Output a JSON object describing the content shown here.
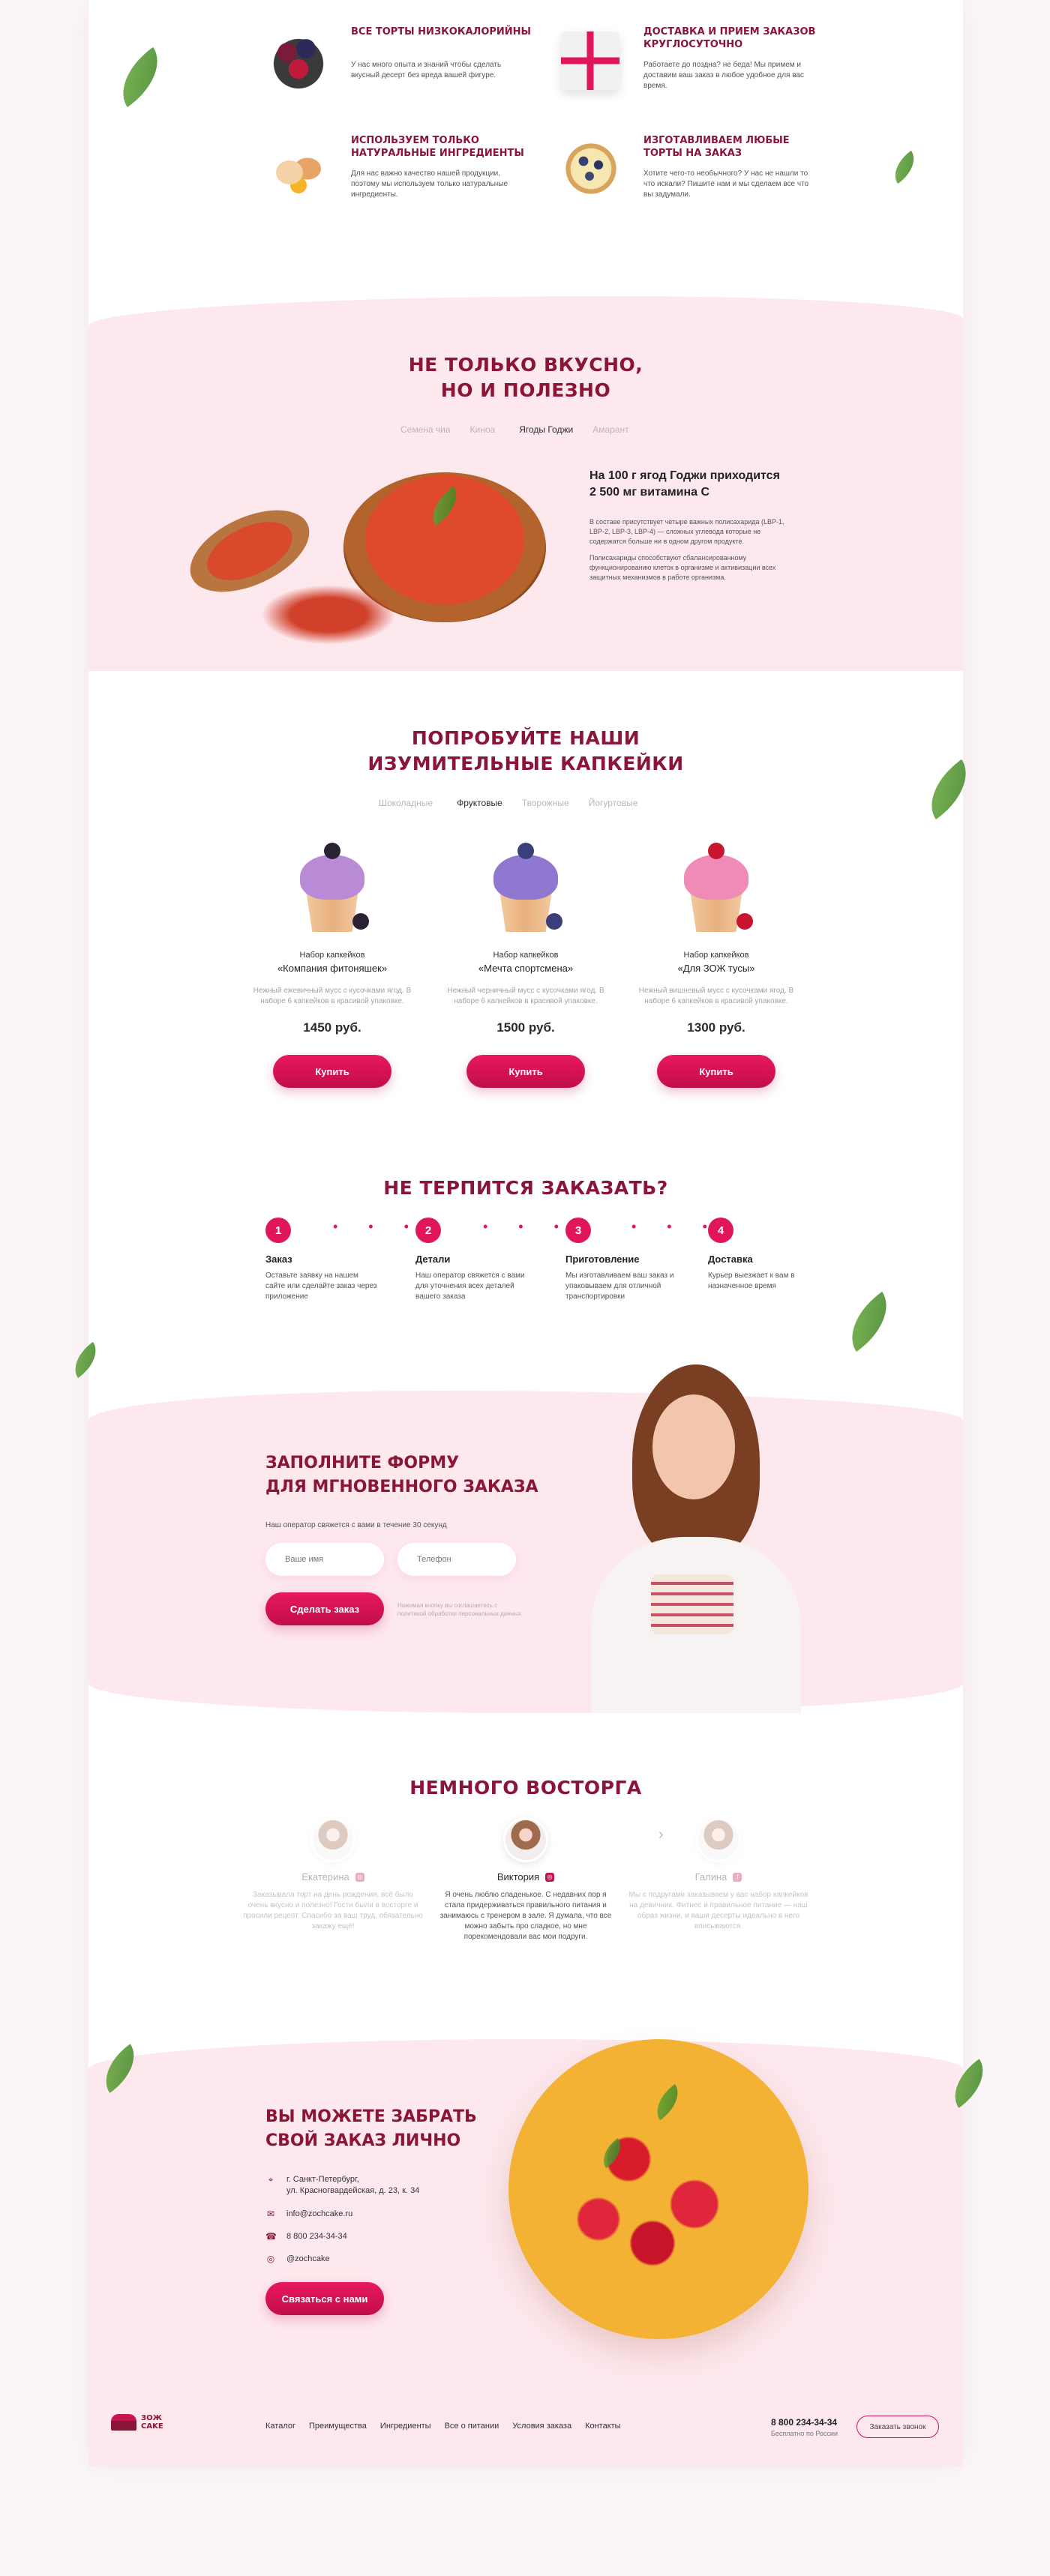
{
  "features": [
    {
      "title": "Все торты низкокалорийны",
      "desc": "У нас много опыта и знаний чтобы сделать вкусный десерт без вреда вашей фигуре.",
      "icon": "berries-bowl-icon"
    },
    {
      "title": "Доставка и прием заказов круглосуточно",
      "desc": "Работаете до поздна? не беда! Мы примем и доставим ваш заказ в любое удобное для вас время.",
      "icon": "gift-box-icon"
    },
    {
      "title": "Используем только натуральные ингредиенты",
      "desc": "Для нас важно качество нашей продукции, поэтому мы используем только натуральные ингредиенты.",
      "icon": "eggs-icon"
    },
    {
      "title": "Изготавливаем любые торты на заказ",
      "desc": "Хотите чего-то необычного? У нас не нашли то что искали? Пишите нам и мы сделаем все что вы задумали.",
      "icon": "blueberry-tart-icon"
    }
  ],
  "benefits": {
    "title_line1": "Не только вкусно,",
    "title_line2": "но и полезно",
    "tabs": [
      "Семена чиа",
      "Киноа",
      "Ягоды Годжи",
      "Амарант"
    ],
    "active_tab": "Ягоды Годжи",
    "heading_line1": "На 100 г ягод Годжи приходится",
    "heading_line2": "2 500 мг витамина С",
    "para1": "В составе присутствует четыре важных полисахарида (LBP-1, LBP-2, LBP-3, LBP-4) — сложных углевода которые не содержатся больше ни в одном другом продукте.",
    "para2": "Полисахариды способствуют сбалансированному функционированию клеток в организме и активизации всех защитных механизмов в работе организма."
  },
  "cupcakes": {
    "title_line1": "Попробуйте наши",
    "title_line2": "изумительные капкейки",
    "tabs": [
      "Шоколадные",
      "Фруктовые",
      "Творожные",
      "Йогуртовые"
    ],
    "active_tab": "Фруктовые",
    "items": [
      {
        "kind": "Набор капкейков",
        "name": "«Компания фитоняшек»",
        "desc": "Нежный ежевичный мусс с кусочками ягод. В наборе 6 капкейков в красивой упаковке.",
        "price": "1450 руб.",
        "button": "Купить"
      },
      {
        "kind": "Набор капкейков",
        "name": "«Мечта спортсмена»",
        "desc": "Нежный черничный мусс с кусочками ягод. В наборе 6 капкейков в красивой упаковке.",
        "price": "1500 руб.",
        "button": "Купить"
      },
      {
        "kind": "Набор капкейков",
        "name": "«Для ЗОЖ тусы»",
        "desc": "Нежный вишневый мусс с кусочками ягод. В наборе 6 капкейков в красивой упаковке.",
        "price": "1300 руб.",
        "button": "Купить"
      }
    ]
  },
  "order_steps": {
    "title": "Не терпится заказать?",
    "steps": [
      {
        "num": "1",
        "title": "Заказ",
        "desc": "Оставьте заявку на нашем сайте или сделайте заказ через приложение"
      },
      {
        "num": "2",
        "title": "Детали",
        "desc": "Наш оператор свяжется с вами для уточнения всех деталей вашего заказа"
      },
      {
        "num": "3",
        "title": "Приготовление",
        "desc": "Мы изготавливаем ваш заказ и упаковываем для отличной транспортировки"
      },
      {
        "num": "4",
        "title": "Доставка",
        "desc": "Курьер выезжает к вам в назначенное время"
      }
    ],
    "dots": "• • •"
  },
  "form": {
    "title_line1": "Заполните форму",
    "title_line2": "для мгновенного заказа",
    "subtitle": "Наш оператор свяжется с вами в течение 30 секунд",
    "name_placeholder": "Ваше имя",
    "phone_placeholder": "Телефон",
    "button": "Сделать заказ",
    "note": "Нажимая кнопку вы соглашаетесь с политикой обработки персональных данных"
  },
  "reviews": {
    "title": "Немного восторга",
    "items": [
      {
        "name": "Екатерина",
        "text": "Заказывала торт на день рождения, всё было очень вкусно и полезно! Гости были в восторге и просили рецепт. Спасибо за ваш труд, обязательно закажу ещё!",
        "network": "ig"
      },
      {
        "name": "Виктория",
        "text": "Я очень люблю сладенькое. С недавних пор я стала придерживаться правильного питания и занимаюсь с тренером в зале. Я думала, что все можно забыть про сладкое, но мне порекомендовали вас мои подруги.",
        "network": "ig"
      },
      {
        "name": "Галина",
        "text": "Мы с подругами заказываем у вас набор капкейков на девичник. Фитнес и правильное питание — наш образ жизни, и ваши десерты идеально в него вписываются.",
        "network": "fb"
      }
    ],
    "prev": "‹",
    "next": "›"
  },
  "pickup": {
    "title_line1": "Вы можете забрать",
    "title_line2": "свой заказ лично",
    "address_line1": "г. Санкт-Петербург,",
    "address_line2": "ул. Красногвардейская, д. 23, к. 34",
    "email": "info@zochcake.ru",
    "phone": "8 800 234-34-34",
    "instagram": "@zochcake",
    "button": "Связаться с нами"
  },
  "footer": {
    "logo_line1": "ЗОЖ",
    "logo_line2": "CAKE",
    "nav": [
      "Каталог",
      "Преимущества",
      "Ингредиенты",
      "Все о питании",
      "Условия заказа",
      "Контакты"
    ],
    "phone": "8 800 234-34-34",
    "phone_note": "Бесплатно по России",
    "callback": "Заказать звонок"
  },
  "colors": {
    "accent": "#e0155b",
    "brand": "#8b1538",
    "pink_bg": "#fde8ed"
  }
}
